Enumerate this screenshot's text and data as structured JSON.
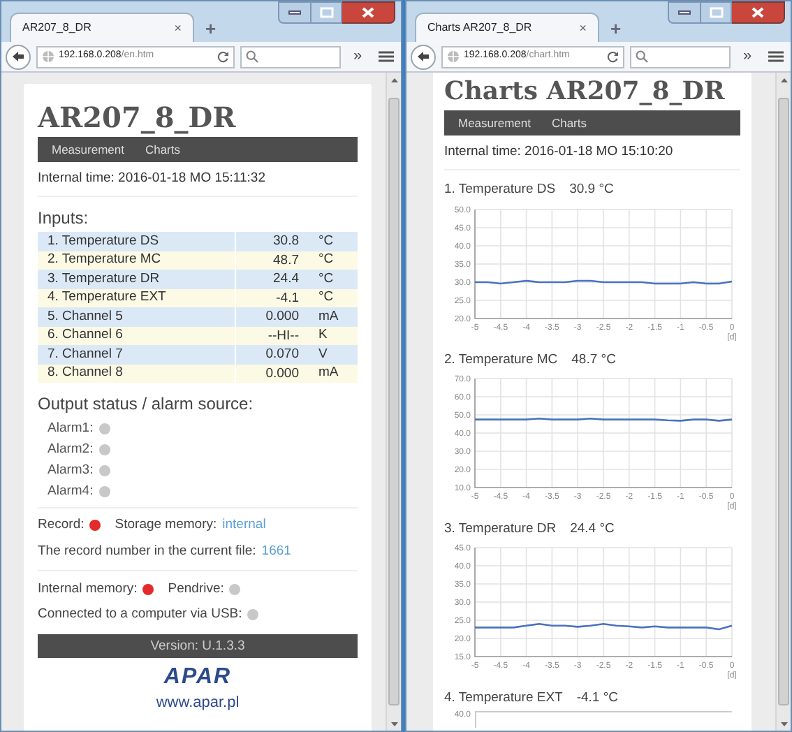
{
  "windows": [
    {
      "tab": {
        "title": "AR207_8_DR",
        "close": "×"
      },
      "new_tab": "+",
      "url": {
        "host": "192.168.0.208",
        "path": "/en.htm"
      },
      "overflow": "»",
      "page": {
        "kind": "measurement",
        "title": "AR207_8_DR",
        "nav": [
          "Measurement",
          "Charts"
        ],
        "internal_time": "Internal time: 2016-01-18 MO 15:11:32",
        "inputs_heading": "Inputs:",
        "inputs": [
          {
            "name": "1. Temperature DS",
            "value": "30.8",
            "unit": "°C"
          },
          {
            "name": "2. Temperature MC",
            "value": "48.7",
            "unit": "°C"
          },
          {
            "name": "3. Temperature DR",
            "value": "24.4",
            "unit": "°C"
          },
          {
            "name": "4. Temperature EXT",
            "value": "-4.1",
            "unit": "°C"
          },
          {
            "name": "5. Channel 5",
            "value": "0.000",
            "unit": "mA"
          },
          {
            "name": "6. Channel 6",
            "value": "--HI--",
            "unit": "K"
          },
          {
            "name": "7. Channel 7",
            "value": "0.070",
            "unit": "V"
          },
          {
            "name": "8. Channel 8",
            "value": "0.000",
            "unit": "mA"
          }
        ],
        "outputs_heading": "Output status / alarm source:",
        "alarms": [
          {
            "label": "Alarm1:",
            "on": false
          },
          {
            "label": "Alarm2:",
            "on": false
          },
          {
            "label": "Alarm3:",
            "on": false
          },
          {
            "label": "Alarm4:",
            "on": false
          }
        ],
        "record": {
          "label": "Record:",
          "on": true
        },
        "storage": {
          "label": "Storage memory:",
          "value": "internal"
        },
        "record_number": {
          "label": "The record number in the current file:",
          "value": "1661"
        },
        "internal_memory": {
          "label": "Internal memory:",
          "on": true
        },
        "pendrive": {
          "label": "Pendrive:",
          "on": false
        },
        "usb": {
          "label": "Connected to a computer via USB:",
          "on": false
        },
        "version": "Version: U.1.3.3",
        "logo": "APAR",
        "website": "www.apar.pl"
      }
    },
    {
      "tab": {
        "title": "Charts AR207_8_DR",
        "close": "×"
      },
      "new_tab": "+",
      "url": {
        "host": "192.168.0.208",
        "path": "/chart.htm"
      },
      "overflow": "»",
      "page": {
        "kind": "charts",
        "title": "Charts AR207_8_DR",
        "nav": [
          "Measurement",
          "Charts"
        ],
        "internal_time": "Internal time: 2016-01-18 MO 15:10:20",
        "charts": [
          {
            "kind": "full",
            "name": "1. Temperature DS",
            "reading": "30.9 °C",
            "chart_data": {
              "type": "line",
              "xlabel": "[d]",
              "x": [
                -5,
                -4.75,
                -4.5,
                -4.25,
                -4,
                -3.75,
                -3.5,
                -3.25,
                -3,
                -2.75,
                -2.5,
                -2.25,
                -2,
                -1.75,
                -1.5,
                -1.25,
                -1,
                -0.75,
                -0.5,
                -0.25,
                0
              ],
              "xlim": [
                -5,
                0
              ],
              "ylim": [
                20,
                50
              ],
              "xticks": [
                -5,
                -4.5,
                -4,
                -3.5,
                -3,
                -2.5,
                -2,
                -1.5,
                -1,
                -0.5,
                0
              ],
              "yticks": [
                {
                  "value": 20,
                  "label": "20.0"
                },
                {
                  "value": 25,
                  "label": "25.0"
                },
                {
                  "value": 30,
                  "label": "30.0"
                },
                {
                  "value": 35,
                  "label": "35.0"
                },
                {
                  "value": 40,
                  "label": "40.0"
                },
                {
                  "value": 45,
                  "label": "45.0"
                },
                {
                  "value": 50,
                  "label": "50.0"
                }
              ],
              "grid": true,
              "series": [
                {
                  "color": "#4a72c0",
                  "values": [
                    30,
                    30,
                    29.6,
                    30,
                    30.4,
                    30,
                    30,
                    30,
                    30.4,
                    30.4,
                    30,
                    30,
                    30,
                    30,
                    29.6,
                    29.6,
                    29.6,
                    30,
                    29.6,
                    29.6,
                    30.2
                  ]
                }
              ]
            }
          },
          {
            "kind": "full",
            "name": "2. Temperature MC",
            "reading": "48.7 °C",
            "chart_data": {
              "type": "line",
              "xlabel": "[d]",
              "x": [
                -5,
                -4.75,
                -4.5,
                -4.25,
                -4,
                -3.75,
                -3.5,
                -3.25,
                -3,
                -2.75,
                -2.5,
                -2.25,
                -2,
                -1.75,
                -1.5,
                -1.25,
                -1,
                -0.75,
                -0.5,
                -0.25,
                0
              ],
              "xlim": [
                -5,
                0
              ],
              "ylim": [
                10,
                70
              ],
              "xticks": [
                -5,
                -4.5,
                -4,
                -3.5,
                -3,
                -2.5,
                -2,
                -1.5,
                -1,
                -0.5,
                0
              ],
              "yticks": [
                {
                  "value": 10,
                  "label": "10.0"
                },
                {
                  "value": 20,
                  "label": "20.0"
                },
                {
                  "value": 30,
                  "label": "30.0"
                },
                {
                  "value": 40,
                  "label": "40.0"
                },
                {
                  "value": 50,
                  "label": "50.0"
                },
                {
                  "value": 60,
                  "label": "60.0"
                },
                {
                  "value": 70,
                  "label": "70.0"
                }
              ],
              "grid": true,
              "series": [
                {
                  "color": "#4a72c0",
                  "values": [
                    47.5,
                    47.5,
                    47.5,
                    47.5,
                    47.5,
                    48,
                    47.5,
                    47.5,
                    47.5,
                    48,
                    47.5,
                    47.5,
                    47.5,
                    47.5,
                    47.5,
                    47,
                    46.8,
                    47.5,
                    47.5,
                    46.8,
                    47.5
                  ]
                }
              ]
            }
          },
          {
            "kind": "full",
            "name": "3. Temperature DR",
            "reading": "24.4 °C",
            "chart_data": {
              "type": "line",
              "xlabel": "[d]",
              "x": [
                -5,
                -4.75,
                -4.5,
                -4.25,
                -4,
                -3.75,
                -3.5,
                -3.25,
                -3,
                -2.75,
                -2.5,
                -2.25,
                -2,
                -1.75,
                -1.5,
                -1.25,
                -1,
                -0.75,
                -0.5,
                -0.25,
                0
              ],
              "xlim": [
                -5,
                0
              ],
              "ylim": [
                15,
                45
              ],
              "xticks": [
                -5,
                -4.5,
                -4,
                -3.5,
                -3,
                -2.5,
                -2,
                -1.5,
                -1,
                -0.5,
                0
              ],
              "yticks": [
                {
                  "value": 15,
                  "label": "15.0"
                },
                {
                  "value": 20,
                  "label": "20.0"
                },
                {
                  "value": 25,
                  "label": "25.0"
                },
                {
                  "value": 30,
                  "label": "30.0"
                },
                {
                  "value": 35,
                  "label": "35.0"
                },
                {
                  "value": 40,
                  "label": "40.0"
                },
                {
                  "value": 45,
                  "label": "45.0"
                }
              ],
              "grid": true,
              "series": [
                {
                  "color": "#4a72c0",
                  "values": [
                    23,
                    23,
                    23,
                    23,
                    23.5,
                    24,
                    23.5,
                    23.5,
                    23.2,
                    23.5,
                    24,
                    23.5,
                    23.3,
                    23,
                    23.3,
                    23,
                    23,
                    23,
                    23,
                    22.5,
                    23.5
                  ]
                }
              ]
            }
          },
          {
            "kind": "partial",
            "name": "4. Temperature EXT",
            "reading": "-4.1 °C",
            "top_tick": "40.0"
          }
        ]
      }
    }
  ]
}
